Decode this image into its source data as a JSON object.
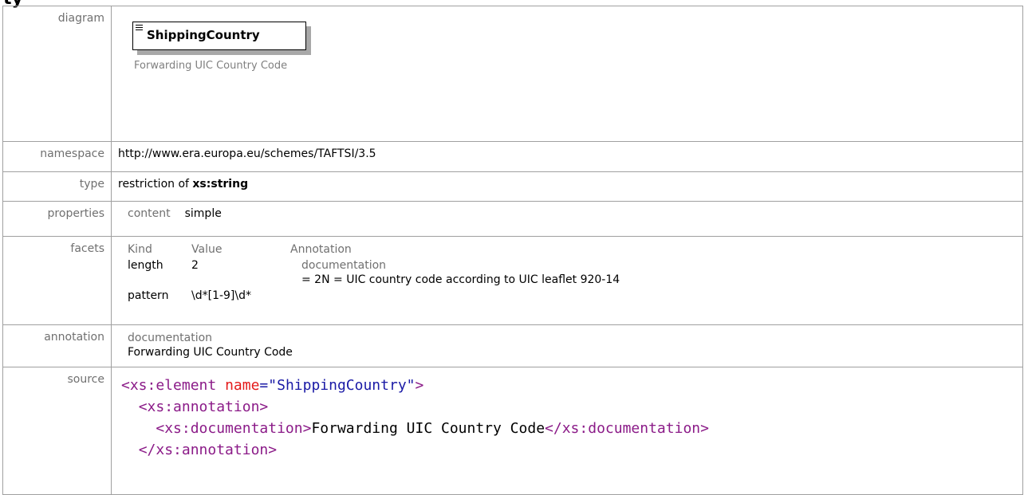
{
  "header_fragment": "ty",
  "rows": {
    "diagram": {
      "label": "diagram",
      "element_name": "ShippingCountry",
      "element_doc": "Forwarding UIC Country Code",
      "icon": "element-icon"
    },
    "namespace": {
      "label": "namespace",
      "value": "http://www.era.europa.eu/schemes/TAFTSI/3.5"
    },
    "type": {
      "label": "type",
      "prefix": "restriction of ",
      "base": "xs:string"
    },
    "properties": {
      "label": "properties",
      "key": "content",
      "value": "simple"
    },
    "facets": {
      "label": "facets",
      "headers": [
        "Kind",
        "Value",
        "Annotation"
      ],
      "items": [
        {
          "kind": "length",
          "value": "2",
          "anno_label": "documentation",
          "anno_text": "= 2N = UIC country code according to UIC leaflet 920-14"
        },
        {
          "kind": "pattern",
          "value": "\\d*[1-9]\\d*",
          "anno_label": "",
          "anno_text": ""
        }
      ]
    },
    "annotation": {
      "label": "annotation",
      "sub_label": "documentation",
      "text": "Forwarding UIC Country Code"
    },
    "source": {
      "label": "source",
      "line1_open": "<xs:element",
      "line1_attr": "name",
      "line1_eq": "=",
      "line1_val": "\"ShippingCountry\"",
      "line1_close": ">",
      "line2": "<xs:annotation>",
      "line3_open": "<xs:documentation>",
      "line3_text": "Forwarding UIC Country Code",
      "line3_close": "</xs:documentation>",
      "line4": "</xs:annotation>"
    }
  }
}
